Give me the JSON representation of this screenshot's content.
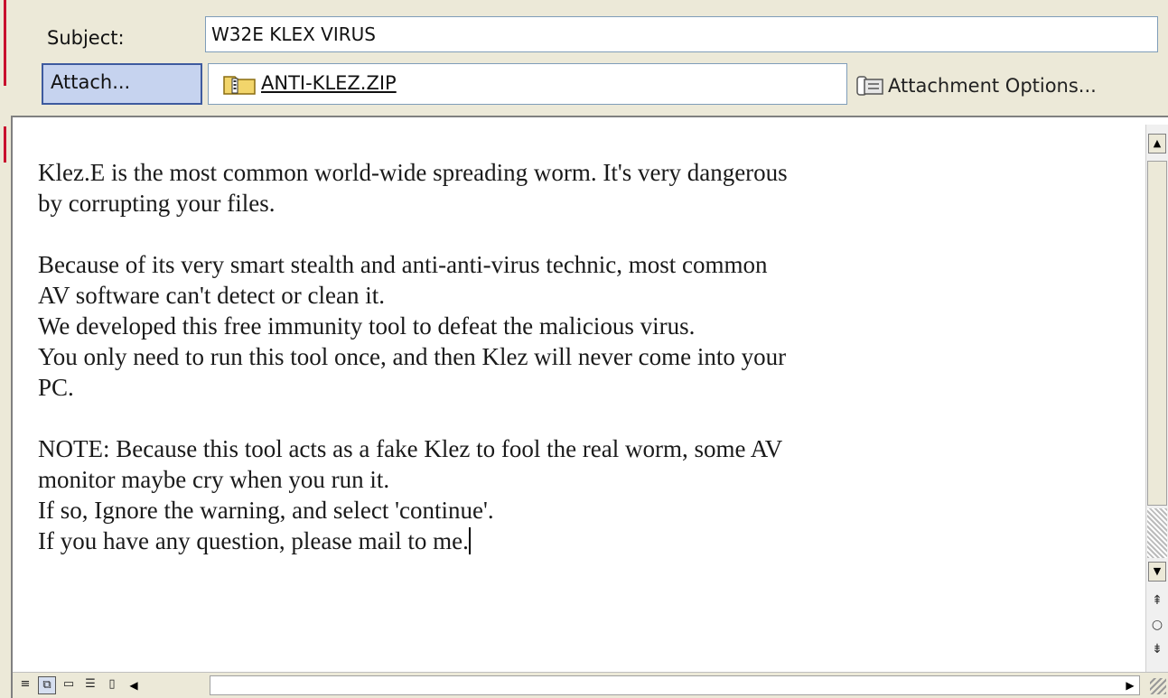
{
  "header": {
    "subject_label": "Subject:",
    "subject_value": "W32E KLEX VIRUS",
    "attach_button_label": "Attach...",
    "attachment_name": "ANTI-KLEZ.ZIP",
    "attachment_options_label": "Attachment Options..."
  },
  "body": {
    "lines": [
      "Klez.E is the most common world-wide spreading worm. It's very dangerous",
      "by corrupting your files.",
      "",
      "Because of its very smart stealth and anti-anti-virus technic, most common",
      "AV software can't detect or clean it.",
      "We developed this free immunity tool to defeat the malicious virus.",
      "You only need to run this tool once, and then Klez will never come into your",
      "PC.",
      "",
      "NOTE: Because this tool acts as a fake Klez to fool the real worm, some AV",
      "monitor maybe cry when you run it.",
      "If so, Ignore the warning, and select 'continue'.",
      "If you have any question, please mail to me."
    ]
  },
  "icons": {
    "zip": "folder-zip-icon",
    "attachment_options": "attachment-options-icon"
  },
  "colors": {
    "chrome": "#ece9d8",
    "attach_button_bg": "#c6d3ef",
    "attach_button_border": "#3d5a9e"
  }
}
